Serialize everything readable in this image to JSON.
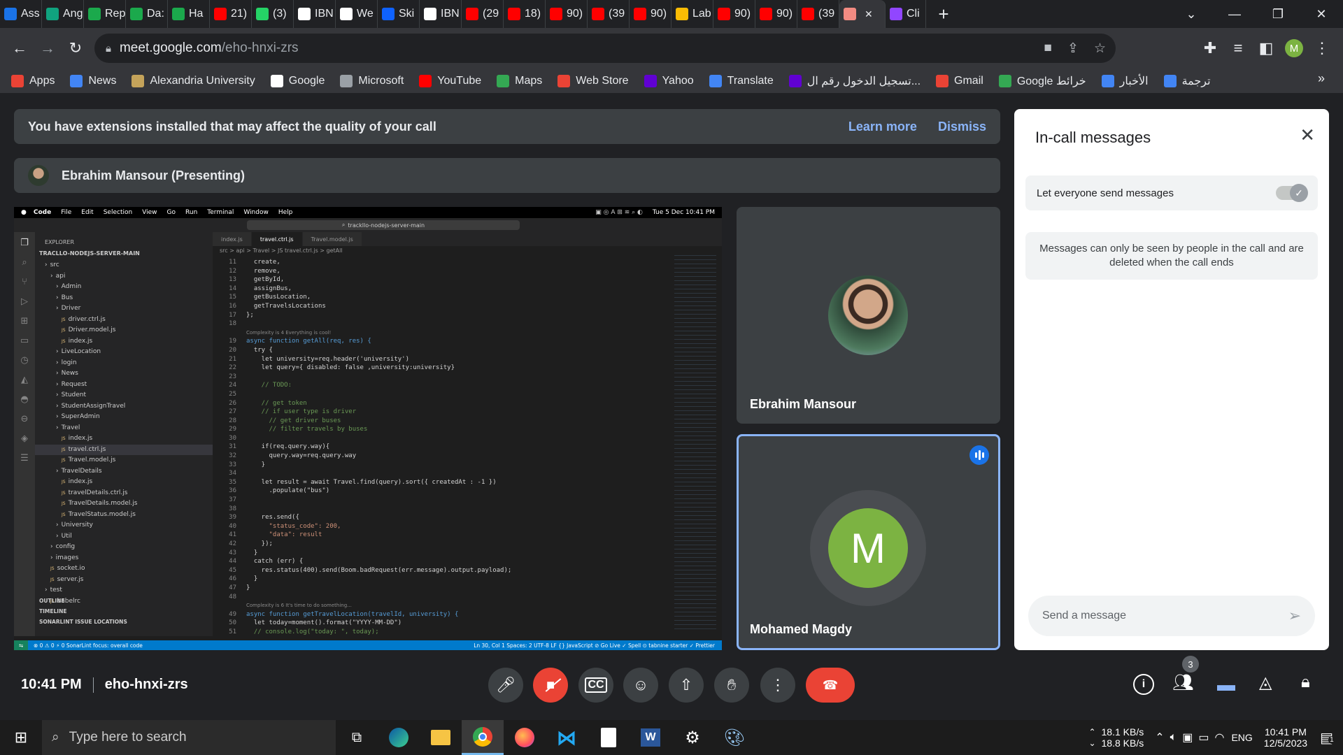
{
  "browser": {
    "tabs": [
      {
        "label": "Ass",
        "icon": "classroom-icon",
        "color": "#1a73e8"
      },
      {
        "label": "Ang",
        "icon": "chatgpt-icon",
        "color": "#10a37f"
      },
      {
        "label": "Rep",
        "icon": "hackerrank-icon",
        "color": "#1ba94c"
      },
      {
        "label": "Da:",
        "icon": "hackerrank-icon",
        "color": "#1ba94c"
      },
      {
        "label": "Ha",
        "icon": "hackerrank-icon",
        "color": "#1ba94c"
      },
      {
        "label": "21)",
        "icon": "youtube-icon",
        "color": "#ff0000"
      },
      {
        "label": "(3)",
        "icon": "whatsapp-icon",
        "color": "#25d366"
      },
      {
        "label": "IBN",
        "icon": "coursera-icon",
        "color": "#ffffff"
      },
      {
        "label": "We",
        "icon": "coursera-icon",
        "color": "#ffffff"
      },
      {
        "label": "Ski",
        "icon": "skillsnetwork-icon",
        "color": "#0f62fe"
      },
      {
        "label": "IBN",
        "icon": "coursera-icon",
        "color": "#ffffff"
      },
      {
        "label": "(29",
        "icon": "youtube-icon",
        "color": "#ff0000"
      },
      {
        "label": "18)",
        "icon": "youtube-icon",
        "color": "#ff0000"
      },
      {
        "label": "90)",
        "icon": "youtube-icon",
        "color": "#ff0000"
      },
      {
        "label": "(39",
        "icon": "youtube-icon",
        "color": "#ff0000"
      },
      {
        "label": "90)",
        "icon": "youtube-icon",
        "color": "#ff0000"
      },
      {
        "label": "Lab",
        "icon": "drive-icon",
        "color": "#fbbc04"
      },
      {
        "label": "90)",
        "icon": "youtube-icon",
        "color": "#ff0000"
      },
      {
        "label": "90)",
        "icon": "youtube-icon",
        "color": "#ff0000"
      },
      {
        "label": "(39",
        "icon": "youtube-icon",
        "color": "#ff0000"
      },
      {
        "label": "",
        "icon": "recording-icon",
        "color": "#f28b82",
        "active": true
      },
      {
        "label": "Cli",
        "icon": "twitch-icon",
        "color": "#9146ff"
      }
    ],
    "new_tab": "+",
    "url_host": "meet.google.com",
    "url_path": "/eho-hnxi-zrs",
    "profile_initial": "M",
    "bookmarks": [
      {
        "label": "Apps",
        "icon": "apps-grid-icon",
        "color": "#ea4335"
      },
      {
        "label": "News",
        "icon": "google-news-icon",
        "color": "#4285f4"
      },
      {
        "label": "Alexandria University",
        "icon": "university-seal-icon",
        "color": "#c4a35a"
      },
      {
        "label": "Google",
        "icon": "google-icon",
        "color": "#ffffff"
      },
      {
        "label": "Microsoft",
        "icon": "globe-icon",
        "color": "#9aa0a6"
      },
      {
        "label": "YouTube",
        "icon": "youtube-icon",
        "color": "#ff0000"
      },
      {
        "label": "Maps",
        "icon": "maps-icon",
        "color": "#34a853"
      },
      {
        "label": "Web Store",
        "icon": "webstore-icon",
        "color": "#ea4335"
      },
      {
        "label": "Yahoo",
        "icon": "yahoo-icon",
        "color": "#6001d2"
      },
      {
        "label": "Translate",
        "icon": "translate-icon",
        "color": "#4285f4"
      },
      {
        "label": "تسجيل الدخول رقم ال...",
        "icon": "web-icon",
        "color": "#6001d2"
      },
      {
        "label": "Gmail",
        "icon": "gmail-icon",
        "color": "#ea4335"
      },
      {
        "label": "Google خرائط",
        "icon": "maps-icon",
        "color": "#34a853"
      },
      {
        "label": "الأخبار",
        "icon": "google-news-icon",
        "color": "#4285f4"
      },
      {
        "label": "ترجمة",
        "icon": "translate-icon",
        "color": "#4285f4"
      }
    ]
  },
  "meet": {
    "banner_text": "You have extensions installed that may affect the quality of your call",
    "learn_more": "Learn more",
    "dismiss": "Dismiss",
    "presenter_label": "Ebrahim Mansour (Presenting)",
    "participants": [
      {
        "name": "Ebrahim Mansour"
      },
      {
        "name": "Mohamed Magdy",
        "initial": "M",
        "color": "#7cb342"
      }
    ],
    "time": "10:41 PM",
    "meeting_code": "eho-hnxi-zrs",
    "people_count": "3",
    "panel": {
      "title": "In-call messages",
      "toggle_label": "Let everyone send messages",
      "toggle_on": true,
      "info_text": "Messages can only be seen by people in the call and are deleted when the call ends",
      "input_placeholder": "Send a message"
    }
  },
  "vscode": {
    "menu": [
      "Code",
      "File",
      "Edit",
      "Selection",
      "View",
      "Go",
      "Run",
      "Terminal",
      "Window",
      "Help"
    ],
    "clock": "Tue 5 Dec 10:41 PM",
    "search": "trackllo-nodejs-server-main",
    "explorer_title": "EXPLORER",
    "project": "TRACLLO-NODEJS-SERVER-MAIN",
    "tree": [
      "src",
      "api",
      "Admin",
      "Bus",
      "Driver",
      "driver.ctrl.js",
      "Driver.model.js",
      "index.js",
      "LiveLocation",
      "login",
      "News",
      "Request",
      "Student",
      "StudentAssignTravel",
      "SuperAdmin",
      "Travel",
      "index.js",
      "travel.ctrl.js",
      "Travel.model.js",
      "TravelDetails",
      "index.js",
      "travelDetails.ctrl.js",
      "TravelDetails.model.js",
      "TravelStatus.model.js",
      "University",
      "Util",
      "config",
      "images",
      "socket.io",
      "server.js",
      "test",
      "babelrc"
    ],
    "sections": [
      "OUTLINE",
      "TIMELINE",
      "SONARLINT ISSUE LOCATIONS"
    ],
    "tabs": [
      "index.js",
      "travel.ctrl.js",
      "Travel.model.js"
    ],
    "breadcrumb": "src > api > Travel > JS travel.ctrl.js > getAll",
    "line_numbers": [
      "11",
      "12",
      "13",
      "14",
      "15",
      "16",
      "17",
      "18",
      "",
      "19",
      "20",
      "21",
      "22",
      "23",
      "24",
      "25",
      "26",
      "27",
      "28",
      "29",
      "30",
      "31",
      "32",
      "33",
      "34",
      "35",
      "36",
      "37",
      "38",
      "39",
      "40",
      "41",
      "42",
      "43",
      "44",
      "45",
      "46",
      "47",
      "48",
      "",
      "49",
      "50",
      "51"
    ],
    "code_lines": [
      "  create,",
      "  remove,",
      "  getById,",
      "  assignBus,",
      "  getBusLocation,",
      "  getTravelsLocations",
      "};",
      "",
      "Complexity is 4 Everything is cool!",
      "async function getAll(req, res) {",
      "  try {",
      "    let university=req.header('university')",
      "    let query={ disabled: false ,university:university}",
      "",
      "    // TODO:",
      "",
      "    // get token",
      "    // if user type is driver",
      "      // get driver buses",
      "      // filter travels by buses",
      "",
      "    if(req.query.way){",
      "      query.way=req.query.way",
      "    }",
      "",
      "    let result = await Travel.find(query).sort({ createdAt : -1 })",
      "      .populate(\"bus\")",
      "",
      "",
      "    res.send({",
      "      \"status_code\": 200,",
      "      \"data\": result",
      "    });",
      "  }",
      "  catch (err) {",
      "    res.status(400).send(Boom.badRequest(err.message).output.payload);",
      "  }",
      "}",
      "",
      "Complexity is 6 It's time to do something...",
      "async function getTravelLocation(travelId, university) {",
      "  let today=moment().format(\"YYYY-MM-DD\")",
      "  // console.log(\"today: \", today);"
    ],
    "status_left": "⊗ 0 ⚠ 0   ⚡ 0   SonarLint focus: overall code",
    "status_right": "Ln 30, Col 1   Spaces: 2   UTF-8   LF   {} JavaScript   ⊘ Go Live   ✓ Spell   ⊙ tabnine starter   ✓ Prettier"
  },
  "taskbar": {
    "search_placeholder": "Type here to search",
    "net_up": "18.1 KB/s",
    "net_down": "18.8 KB/s",
    "lang": "ENG",
    "time": "10:41 PM",
    "date": "12/5/2023",
    "notif_count": "1"
  }
}
